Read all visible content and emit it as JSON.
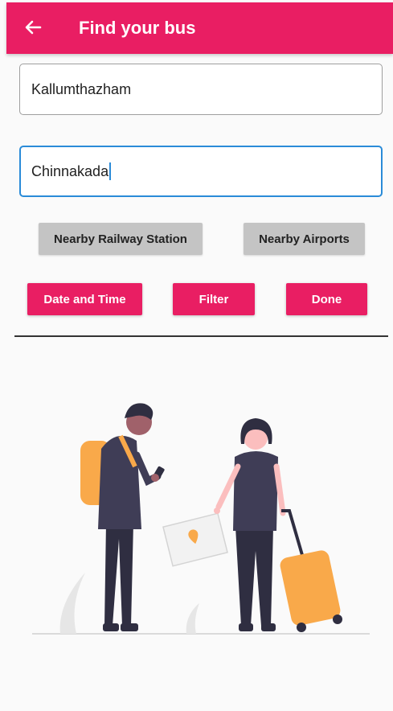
{
  "header": {
    "title": "Find your bus",
    "back_icon": "arrow-left-icon"
  },
  "form": {
    "from": {
      "value": "Kallumthazham"
    },
    "to": {
      "value": "Chinnakada"
    }
  },
  "buttons": {
    "nearby_railway": "Nearby Railway Station",
    "nearby_airports": "Nearby Airports",
    "date_time": "Date and Time",
    "filter": "Filter",
    "done": "Done"
  },
  "colors": {
    "primary": "#e91e63",
    "focus": "#2a8bd8",
    "secondary_button": "#c4c4c4"
  }
}
